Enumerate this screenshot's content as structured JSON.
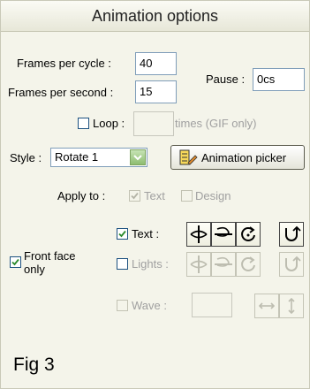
{
  "title": "Animation options",
  "frames_per_cycle": {
    "label": "Frames per cycle :",
    "value": "40"
  },
  "frames_per_second": {
    "label": "Frames per second :",
    "value": "15"
  },
  "pause": {
    "label": "Pause :",
    "value": "0cs"
  },
  "loop": {
    "label": "Loop :",
    "value": "",
    "suffix": "times (GIF only)",
    "checked": false
  },
  "style": {
    "label": "Style :",
    "value": "Rotate 1"
  },
  "animation_picker": {
    "label": "Animation picker"
  },
  "apply_to": {
    "label": "Apply to :",
    "text_label": "Text",
    "design_label": "Design"
  },
  "front_face": {
    "label_line1": "Front face",
    "label_line2": "only",
    "checked": true
  },
  "text_row": {
    "label": "Text :",
    "checked": true
  },
  "lights_row": {
    "label": "Lights :",
    "checked": false
  },
  "wave_row": {
    "label": "Wave :",
    "checked": false,
    "value": ""
  },
  "caption": "Fig 3",
  "colors": {
    "accent": "#1c5180",
    "check": "#2a8a2a",
    "disabled": "#a0a0a0",
    "panel": "#f4f4ea"
  },
  "icons": [
    "rotate-horizontal-icon",
    "flip-horizontal-icon",
    "rotate-circular-icon",
    "u-turn-icon",
    "horizontal-arrows-icon",
    "vertical-arrows-icon"
  ]
}
